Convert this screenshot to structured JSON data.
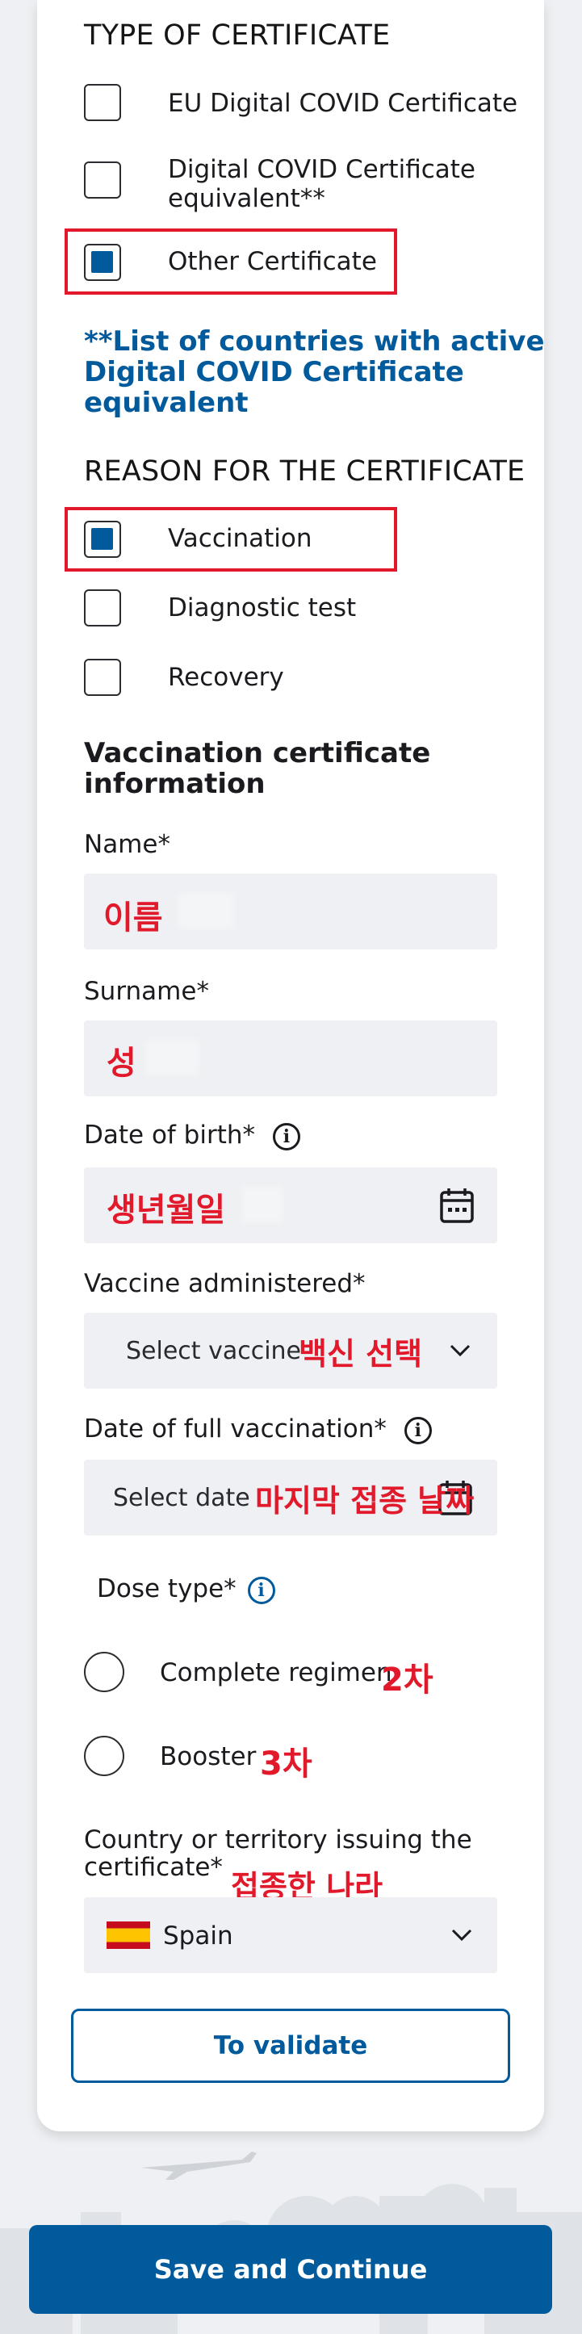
{
  "type_section": {
    "title": "TYPE OF CERTIFICATE",
    "options": [
      {
        "label": "EU Digital COVID Certificate",
        "checked": false
      },
      {
        "label": "Digital COVID Certificate",
        "label2": "equivalent**",
        "checked": false
      },
      {
        "label": "Other Certificate",
        "checked": true
      }
    ],
    "countries_link": [
      "**List of countries with active",
      "Digital COVID Certificate",
      "equivalent"
    ]
  },
  "reason_section": {
    "title": "REASON FOR THE CERTIFICATE",
    "options": [
      {
        "label": "Vaccination",
        "checked": true
      },
      {
        "label": "Diagnostic test",
        "checked": false
      },
      {
        "label": "Recovery",
        "checked": false
      }
    ]
  },
  "vaccination_info": {
    "title_line1": "Vaccination certificate",
    "title_line2": "information",
    "name": {
      "label": "Name*",
      "annotation": "이름"
    },
    "surname": {
      "label": "Surname*",
      "annotation": "성"
    },
    "dob": {
      "label": "Date of birth*",
      "annotation": "생년월일"
    },
    "vaccine": {
      "label": "Vaccine administered*",
      "placeholder": "Select vaccine",
      "annotation": "백신 선택"
    },
    "full_vaccination": {
      "label": "Date of full vaccination*",
      "placeholder": "Select date",
      "annotation": "마지막 접종 날짜"
    },
    "dose_type": {
      "label": "Dose type*",
      "options": [
        {
          "label": "Complete regimen",
          "annotation": "2차"
        },
        {
          "label": "Booster",
          "annotation": "3차"
        }
      ]
    },
    "country": {
      "label_line1": "Country or territory issuing the",
      "label_line2": "certificate*",
      "annotation": "접종한 나라",
      "value": "Spain"
    }
  },
  "buttons": {
    "validate": "To validate",
    "save": "Save and Continue"
  },
  "colors": {
    "accent": "#005a9c",
    "annotation_red": "#e1192b",
    "field_bg": "#eef0f3"
  },
  "icons": {
    "info": "info-icon",
    "calendar": "calendar-icon",
    "dropdown": "chevron-down-icon",
    "flag": "spain-flag-icon"
  }
}
